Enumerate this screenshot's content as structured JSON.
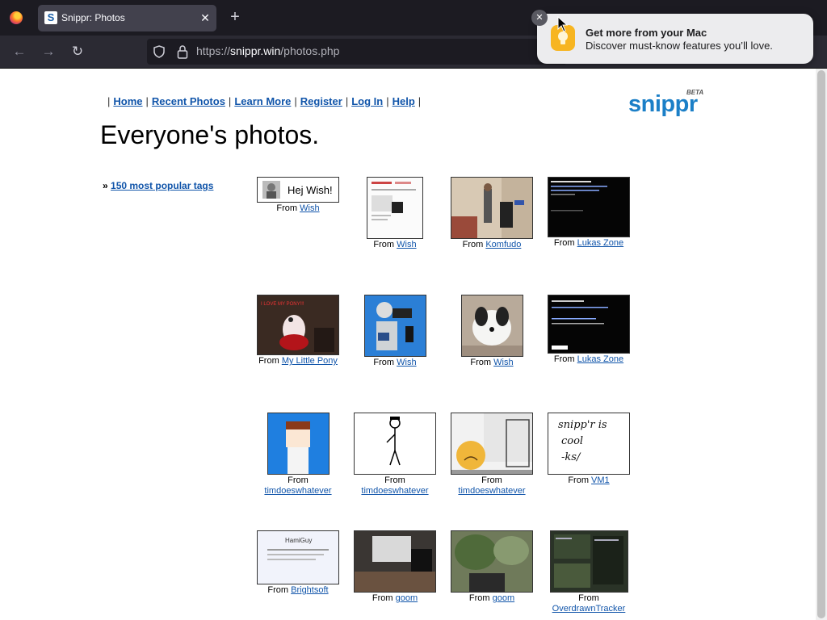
{
  "browser": {
    "tab_title": "Snippr: Photos",
    "tab_favicon_letter": "S",
    "url_prefix": "https://",
    "url_domain": "snippr.win",
    "url_path": "/photos.php"
  },
  "notification": {
    "title": "Get more from your Mac",
    "body": "Discover must-know features you’ll love."
  },
  "page": {
    "nav": [
      "Home",
      "Recent Photos",
      "Learn More",
      "Register",
      "Log In",
      "Help"
    ],
    "logo": "snippr",
    "logo_badge": "BETA",
    "title": "Everyone's photos.",
    "tags_prefix": "»",
    "tags_link": "150 most popular tags",
    "from_label": "From",
    "photos": [
      {
        "source": "Wish",
        "thumb_text": "Hej Wish!"
      },
      {
        "source": "Wish"
      },
      {
        "source": "Komfudo"
      },
      {
        "source": "Lukas Zone"
      },
      {
        "source": "My Little Pony",
        "thumb_text": "I LOVE MY PONY!!!"
      },
      {
        "source": "Wish"
      },
      {
        "source": "Wish"
      },
      {
        "source": "Lukas Zone"
      },
      {
        "source": "timdoeswhatever"
      },
      {
        "source": "timdoeswhatever"
      },
      {
        "source": "timdoeswhatever"
      },
      {
        "source": "VM1",
        "thumb_text": [
          "snipp'r is",
          "cool",
          "-ks/"
        ]
      },
      {
        "source": "Brightsoft",
        "thumb_text": "HamiGuy"
      },
      {
        "source": "goom"
      },
      {
        "source": "goom"
      },
      {
        "source": "OverdrawnTracker"
      }
    ]
  },
  "colors": {
    "link": "#1155aa",
    "logo": "#1b7fc7",
    "tab_bar": "#1c1b22",
    "toolbar": "#2b2a33"
  }
}
